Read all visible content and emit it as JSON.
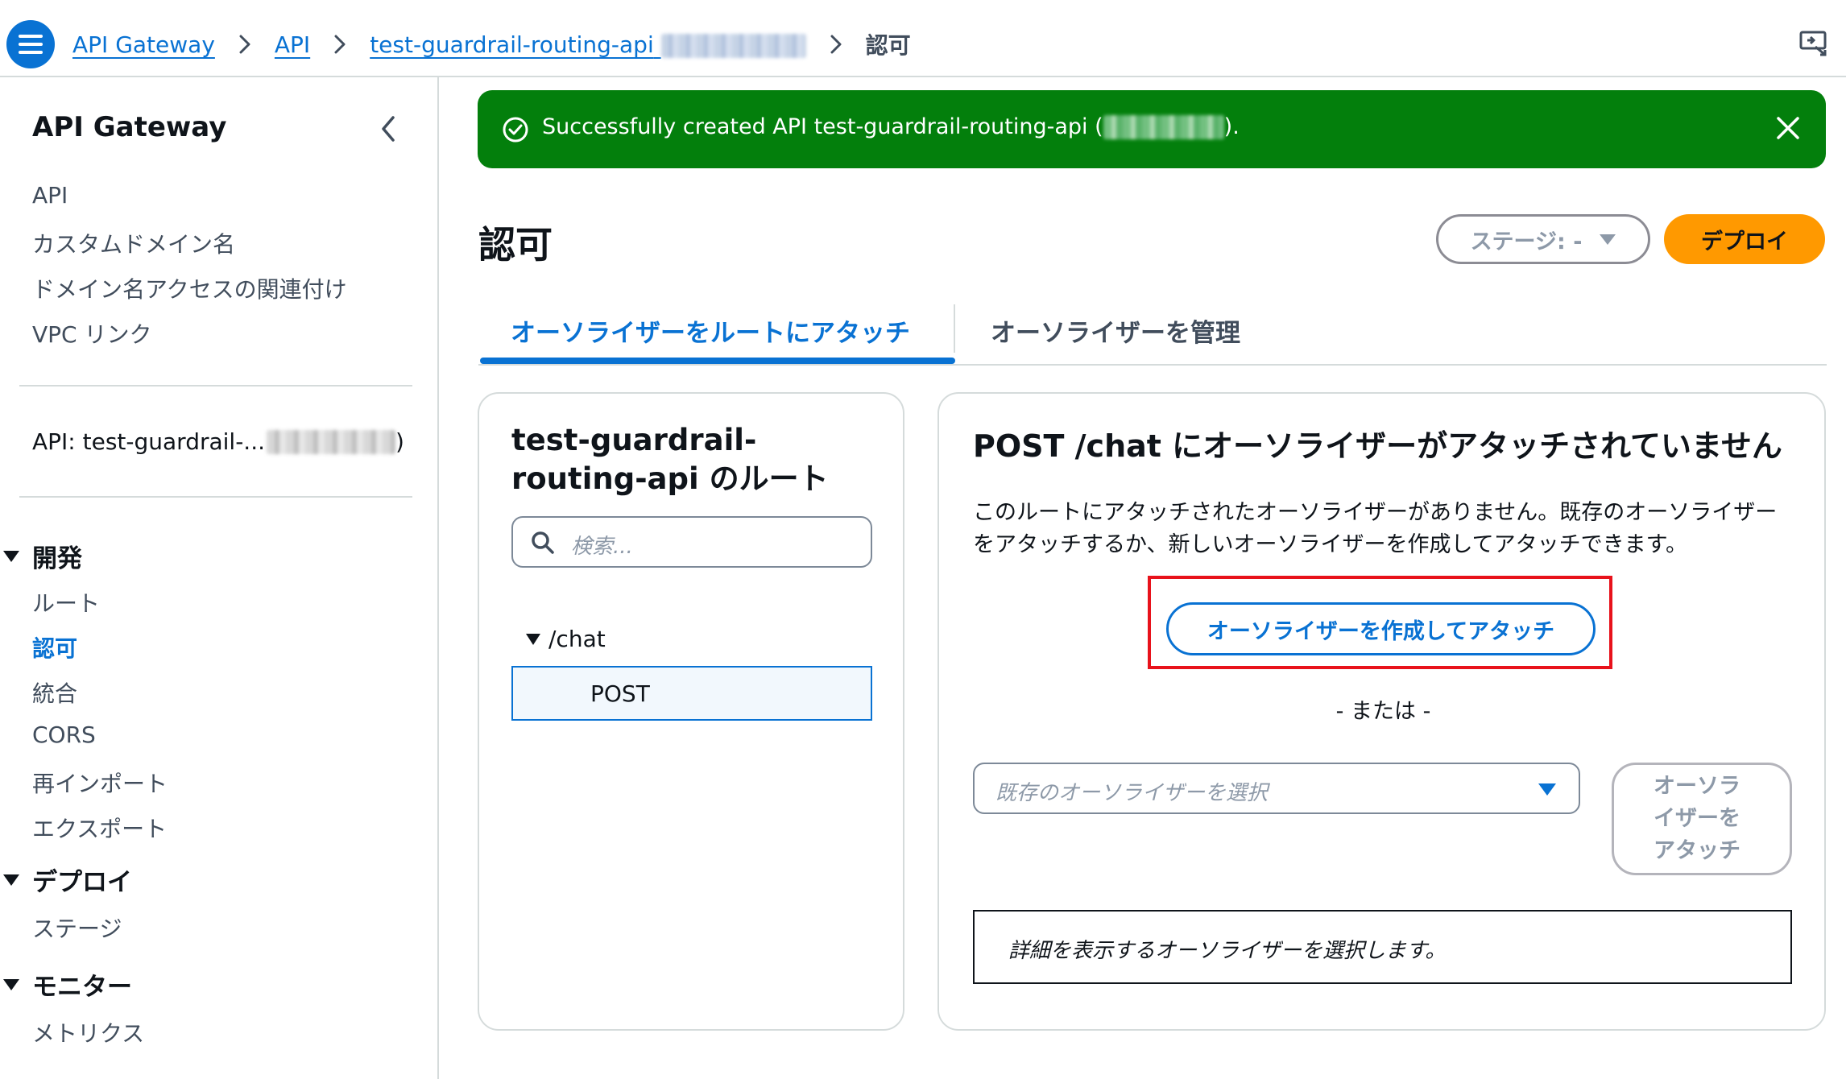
{
  "breadcrumb": {
    "items": [
      "API Gateway",
      "API",
      "test-guardrail-routing-api",
      "認可"
    ]
  },
  "flash": {
    "message_prefix": "Successfully created API test-guardrail-routing-api (",
    "message_suffix": ").",
    "color": "#037f0c"
  },
  "sidebar": {
    "title": "API Gateway",
    "top_items": [
      "API",
      "カスタムドメイン名",
      "ドメイン名アクセスの関連付け",
      "VPC リンク"
    ],
    "api_label": "API: test-guardrail-...",
    "api_label_suffix": ")",
    "sections": [
      {
        "label": "開発",
        "items": [
          "ルート",
          "認可",
          "統合",
          "CORS",
          "再インポート",
          "エクスポート"
        ]
      },
      {
        "label": "デプロイ",
        "items": [
          "ステージ"
        ]
      },
      {
        "label": "モニター",
        "items": [
          "メトリクス"
        ]
      }
    ],
    "active_item": "認可"
  },
  "page": {
    "title": "認可",
    "stage_button": "ステージ: -",
    "deploy_button": "デプロイ"
  },
  "tabs": [
    {
      "label": "オーソライザーをルートにアタッチ",
      "active": true
    },
    {
      "label": "オーソライザーを管理",
      "active": false
    }
  ],
  "routes": {
    "title": "test-guardrail-routing-api のルート",
    "search_placeholder": "検索...",
    "path": "/chat",
    "method": "POST"
  },
  "detail": {
    "title": "POST /chat にオーソライザーがアタッチされていません",
    "description": "このルートにアタッチされたオーソライザーがありません。既存のオーソライザーをアタッチするか、新しいオーソライザーを作成してアタッチできます。",
    "create_button": "オーソライザーを作成してアタッチ",
    "or_text": "- または -",
    "select_placeholder": "既存のオーソライザーを選択",
    "attach_button": "オーソライザーをアタッチ",
    "info_text": "詳細を表示するオーソライザーを選択します。"
  },
  "colors": {
    "accent": "#0972d3",
    "primary_button": "#ff9900",
    "highlight": "#e8121b"
  }
}
